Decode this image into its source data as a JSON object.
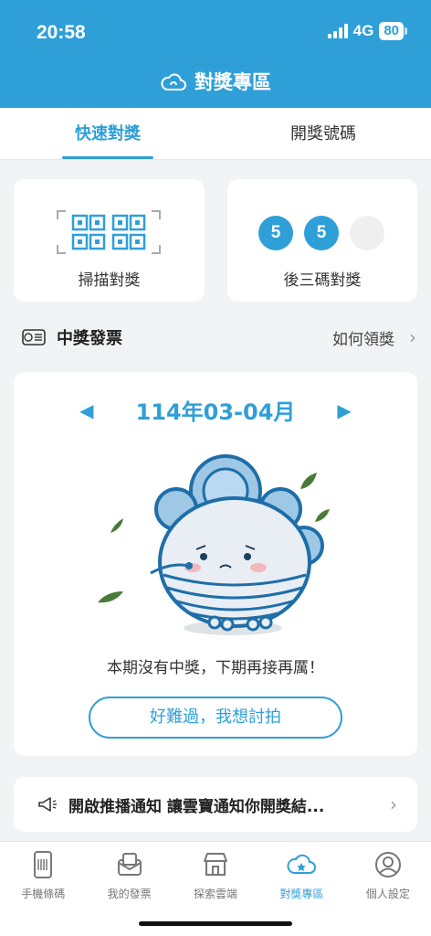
{
  "status_bar": {
    "time": "20:58",
    "network": "4G",
    "battery": "80"
  },
  "header": {
    "title": "對獎專區",
    "icon": "cloud-icon"
  },
  "tabs": [
    {
      "label": "快速對獎",
      "active": true
    },
    {
      "label": "開獎號碼",
      "active": false
    }
  ],
  "actions": {
    "scan_label": "掃描對獎",
    "last3_label": "後三碼對獎",
    "last3_digits": [
      "5",
      "5",
      ""
    ]
  },
  "winning": {
    "title": "中獎發票",
    "link_label": "如何領獎"
  },
  "result": {
    "period": "114年03-04月",
    "message": "本期沒有中獎，下期再接再厲！",
    "button_label": "好難過，我想討拍"
  },
  "notify": {
    "text": "開啟推播通知 讓雲寶通知你開獎結..."
  },
  "bottom_nav": [
    {
      "label": "手機條碼",
      "icon": "barcode-phone-icon",
      "active": false
    },
    {
      "label": "我的發票",
      "icon": "invoice-icon",
      "active": false
    },
    {
      "label": "探索雲端",
      "icon": "store-icon",
      "active": false
    },
    {
      "label": "對獎專區",
      "icon": "cloud-star-icon",
      "active": true
    },
    {
      "label": "個人設定",
      "icon": "profile-icon",
      "active": false
    }
  ],
  "colors": {
    "primary": "#2f9fd8",
    "background": "#f2f3f5"
  }
}
